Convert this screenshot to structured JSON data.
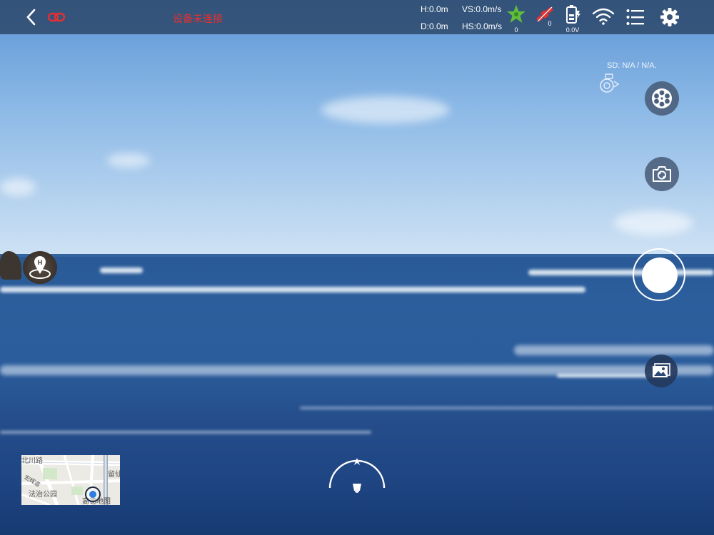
{
  "topbar": {
    "status": "设备未连接",
    "height": "H:0.0m",
    "distance": "D:0.0m",
    "vspeed": "VS:0.0m/s",
    "hspeed": "HS:0.0m/s",
    "gps_count": "0",
    "satellite_count": "0",
    "battery_voltage": "0.0V"
  },
  "side": {
    "sd_status": "SD: N/A / N/A."
  },
  "map": {
    "labels": [
      "北川路",
      "留仙",
      "法治公园",
      "高德地图",
      "宏辉道"
    ]
  },
  "colors": {
    "status_red": "#e53030",
    "gps_green": "#5fbf3a",
    "topbar_bg": "#284060"
  },
  "icons": {
    "back": "chevron-left-icon",
    "link": "broken-link-icon",
    "gps": "gps-star-icon",
    "satellite": "satellite-icon",
    "battery": "battery-icon",
    "wifi": "wifi-icon",
    "menu": "list-menu-icon",
    "settings": "gear-icon",
    "video_mode": "film-reel-icon",
    "photo_mode": "camera-switch-icon",
    "gallery": "gallery-icon",
    "home": "home-point-icon",
    "gimbal": "gimbal-icon"
  }
}
